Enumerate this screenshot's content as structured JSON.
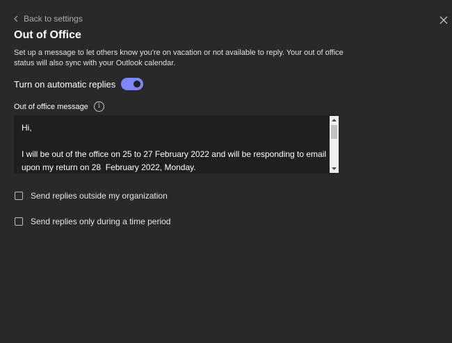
{
  "nav": {
    "back_label": "Back to settings"
  },
  "page": {
    "title": "Out of Office",
    "description": "Set up a message to let others know you're on vacation or not available to reply. Your out of office status will also sync with your Outlook calendar."
  },
  "auto_replies": {
    "label": "Turn on automatic replies",
    "enabled": true
  },
  "message": {
    "label": "Out of office message",
    "value": "Hi,\n\nI will be out of the office on 25 to 27 February 2022 and will be responding to email upon my return on 28  February 2022, Monday."
  },
  "options": {
    "outside_org_label": "Send replies outside my organization",
    "outside_org_checked": false,
    "time_period_label": "Send replies only during a time period",
    "time_period_checked": false
  },
  "colors": {
    "background": "#292929",
    "accent": "#7f85f5",
    "input_background": "#1f1f1f"
  },
  "icons": {
    "back": "chevron-left-icon",
    "close": "close-icon",
    "info": "info-icon"
  }
}
